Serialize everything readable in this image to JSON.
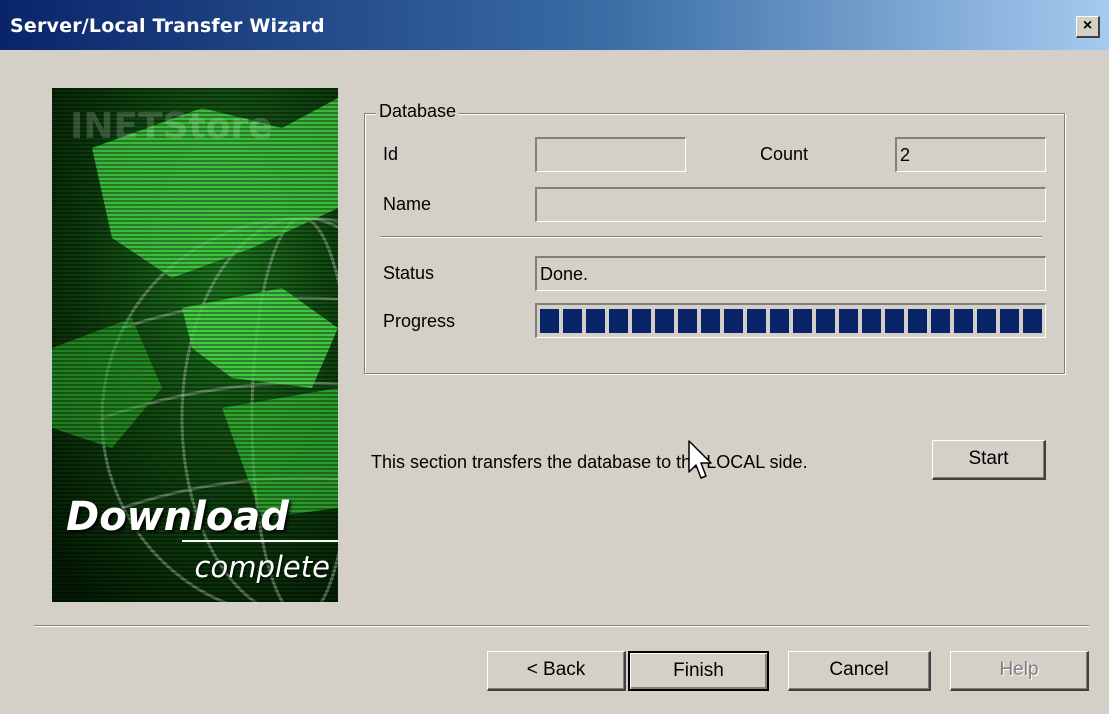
{
  "window": {
    "title": "Server/Local Transfer Wizard",
    "close_label": "×"
  },
  "banner": {
    "main_text": "Download",
    "sub_text": "complete",
    "watermark_text": "INETStore"
  },
  "database": {
    "legend": "Database",
    "id_label": "Id",
    "id_value": "",
    "count_label": "Count",
    "count_value": "2",
    "name_label": "Name",
    "name_value": "",
    "status_label": "Status",
    "status_value": "Done.",
    "progress_label": "Progress",
    "progress_percent": 100
  },
  "info_text": "This section transfers the database to the LOCAL side.",
  "buttons": {
    "start": "Start",
    "back": "< Back",
    "finish": "Finish",
    "cancel": "Cancel",
    "help": "Help"
  },
  "colors": {
    "face": "#d4d0c8",
    "title_active": "#0a246a",
    "progress_block": "#0a246a",
    "banner_green": "#3bd63b"
  }
}
